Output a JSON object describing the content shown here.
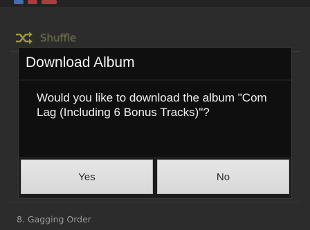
{
  "dialog": {
    "title": "Download Album",
    "message": "Would you like to download the album \"Com Lag (Including 6 Bonus Tracks)\"?",
    "buttons": {
      "yes_label": "Yes",
      "no_label": "No"
    }
  },
  "background": {
    "shuffle_label": "Shuffle",
    "visible_track": "8. Gagging Order",
    "icons": [
      "shuffle-icon"
    ]
  },
  "colors": {
    "dialog_background": "#0f0f0f",
    "button_background": "#e0e0e0",
    "shuffle_icon": "#9a9a2a"
  }
}
